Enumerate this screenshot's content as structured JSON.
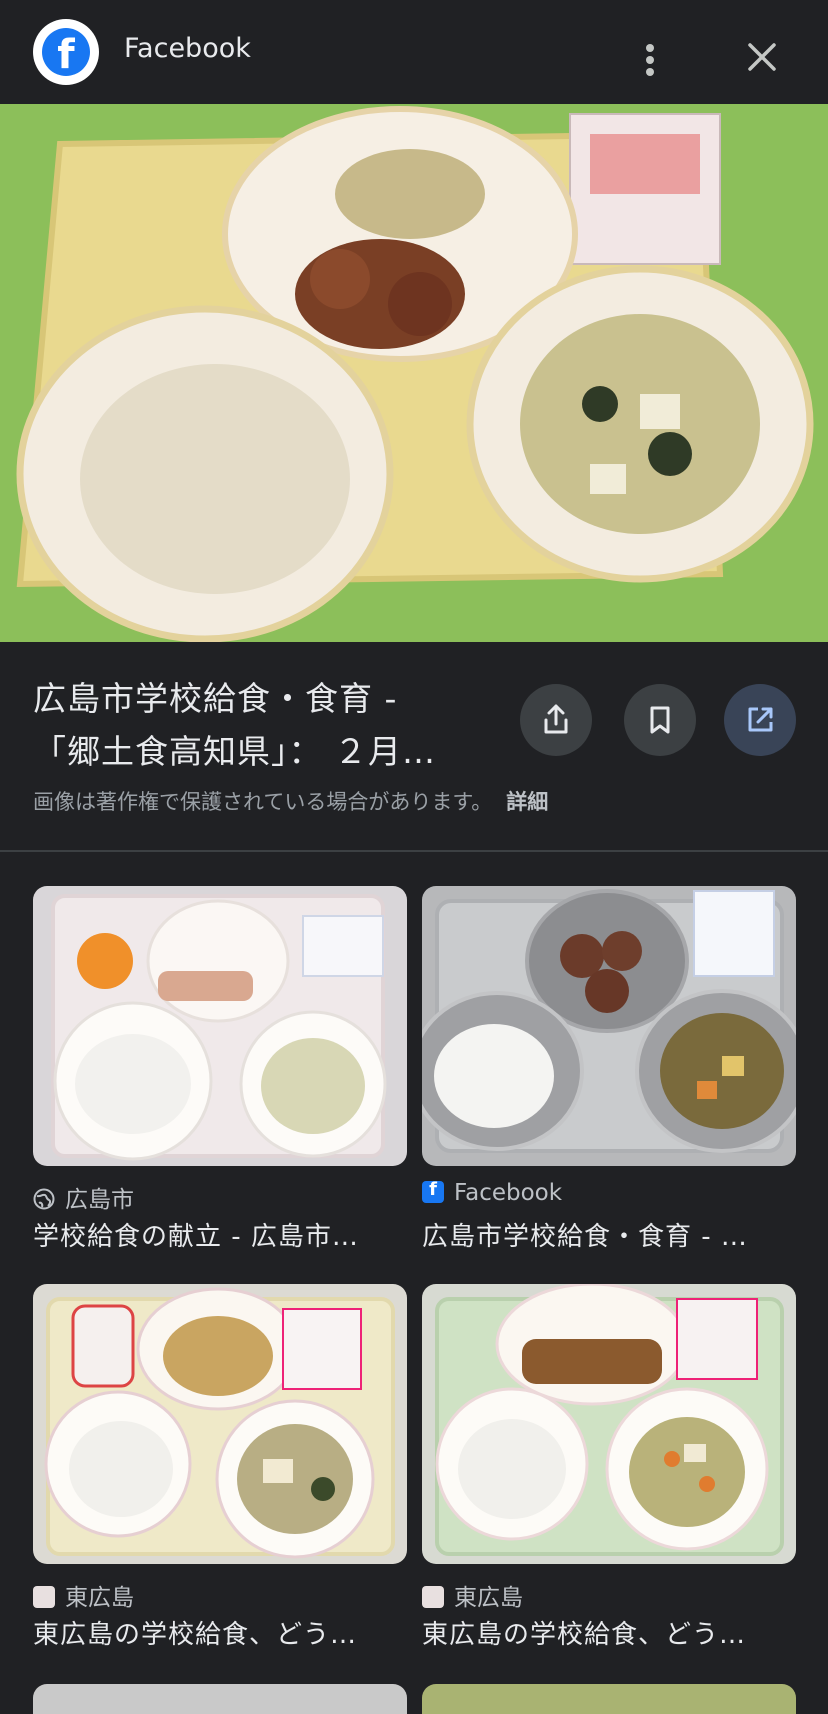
{
  "header": {
    "site_name": "Facebook",
    "logo_icon": "facebook-logo-icon",
    "more_icon": "more-vert-icon",
    "close_icon": "close-icon"
  },
  "hero": {
    "lens_icon": "google-lens-icon"
  },
  "result": {
    "title_line1": "広島市学校給食・食育 -",
    "title_line2": "「郷土食高知県」： ２月…",
    "share_icon": "share-icon",
    "save_icon": "bookmark-icon",
    "visit_icon": "open-in-new-icon",
    "copyright_text": "画像は著作権で保護されている場合があります。",
    "details_label": "詳細"
  },
  "related": [
    {
      "source": "広島市",
      "source_icon": "globe-icon",
      "title": "学校給食の献立 - 広島市…"
    },
    {
      "source": "Facebook",
      "source_icon": "facebook-favicon-icon",
      "title": "広島市学校給食・食育 - …"
    },
    {
      "source": "東広島",
      "source_icon": "higashihiroshima-favicon-icon",
      "title": "東広島の学校給食、どう…"
    },
    {
      "source": "東広島",
      "source_icon": "higashihiroshima-favicon-icon",
      "title": "東広島の学校給食、どう…"
    }
  ],
  "colors": {
    "background": "#202124",
    "accent_button": "#394457",
    "facebook_blue": "#1877f2"
  }
}
